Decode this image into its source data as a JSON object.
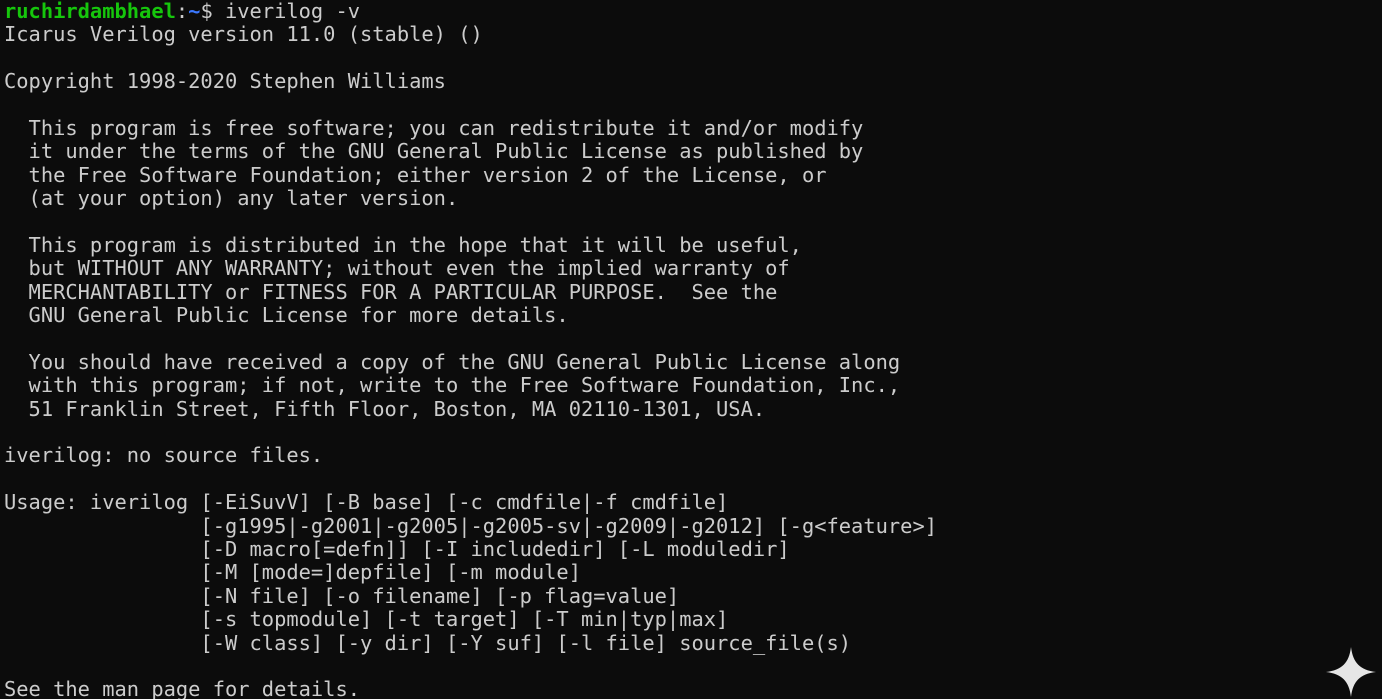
{
  "prompt": {
    "user_host": "ruchirdambhael",
    "separator": ":",
    "path": "~",
    "symbol": "$ ",
    "command": "iverilog -v"
  },
  "output_lines": [
    "Icarus Verilog version 11.0 (stable) ()",
    "",
    "Copyright 1998-2020 Stephen Williams",
    "",
    "  This program is free software; you can redistribute it and/or modify",
    "  it under the terms of the GNU General Public License as published by",
    "  the Free Software Foundation; either version 2 of the License, or",
    "  (at your option) any later version.",
    "",
    "  This program is distributed in the hope that it will be useful,",
    "  but WITHOUT ANY WARRANTY; without even the implied warranty of",
    "  MERCHANTABILITY or FITNESS FOR A PARTICULAR PURPOSE.  See the",
    "  GNU General Public License for more details.",
    "",
    "  You should have received a copy of the GNU General Public License along",
    "  with this program; if not, write to the Free Software Foundation, Inc.,",
    "  51 Franklin Street, Fifth Floor, Boston, MA 02110-1301, USA.",
    "",
    "iverilog: no source files.",
    "",
    "Usage: iverilog [-EiSuvV] [-B base] [-c cmdfile|-f cmdfile]",
    "                [-g1995|-g2001|-g2005|-g2005-sv|-g2009|-g2012] [-g<feature>]",
    "                [-D macro[=defn]] [-I includedir] [-L moduledir]",
    "                [-M [mode=]depfile] [-m module]",
    "                [-N file] [-o filename] [-p flag=value]",
    "                [-s topmodule] [-t target] [-T min|typ|max]",
    "                [-W class] [-y dir] [-Y suf] [-l file] source_file(s)",
    "",
    "See the man page for details."
  ],
  "colors": {
    "background": "#0c0c0c",
    "foreground": "#cccccc",
    "user": "#16c60c",
    "path": "#3b78ff"
  },
  "icons": {
    "corner": "sparkle-icon"
  }
}
